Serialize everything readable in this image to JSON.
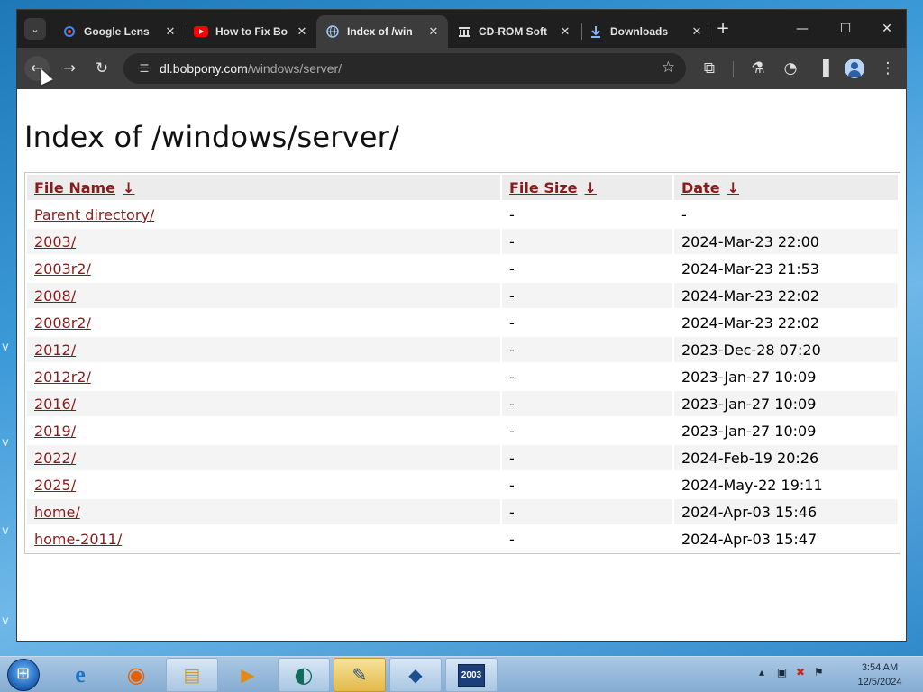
{
  "browser": {
    "tabs": [
      {
        "title": "Google Lens",
        "icon": "google-lens-icon",
        "active": false
      },
      {
        "title": "How to Fix Bo",
        "icon": "youtube-icon",
        "active": false
      },
      {
        "title": "Index of /win",
        "icon": "globe-icon",
        "active": true
      },
      {
        "title": "CD-ROM Soft",
        "icon": "archive-icon",
        "active": false
      },
      {
        "title": "Downloads",
        "icon": "download-icon",
        "active": false
      }
    ],
    "tab_close_glyph": "✕",
    "new_tab_glyph": "+",
    "url_host": "dl.bobpony.com",
    "url_path": "/windows/server/"
  },
  "page": {
    "title": "Index of /windows/server/",
    "headers": {
      "name": "File Name",
      "size": "File Size",
      "date": "Date",
      "sort_arrow": "↓"
    },
    "rows": [
      {
        "name": "Parent directory/",
        "size": "-",
        "date": "-"
      },
      {
        "name": "2003/",
        "size": "-",
        "date": "2024-Mar-23 22:00"
      },
      {
        "name": "2003r2/",
        "size": "-",
        "date": "2024-Mar-23 21:53"
      },
      {
        "name": "2008/",
        "size": "-",
        "date": "2024-Mar-23 22:02"
      },
      {
        "name": "2008r2/",
        "size": "-",
        "date": "2024-Mar-23 22:02"
      },
      {
        "name": "2012/",
        "size": "-",
        "date": "2023-Dec-28 07:20"
      },
      {
        "name": "2012r2/",
        "size": "-",
        "date": "2023-Jan-27 10:09"
      },
      {
        "name": "2016/",
        "size": "-",
        "date": "2023-Jan-27 10:09"
      },
      {
        "name": "2019/",
        "size": "-",
        "date": "2023-Jan-27 10:09"
      },
      {
        "name": "2022/",
        "size": "-",
        "date": "2024-Feb-19 20:26"
      },
      {
        "name": "2025/",
        "size": "-",
        "date": "2024-May-22 19:11"
      },
      {
        "name": "home/",
        "size": "-",
        "date": "2024-Apr-03 15:46"
      },
      {
        "name": "home-2011/",
        "size": "-",
        "date": "2024-Apr-03 15:47"
      }
    ]
  },
  "taskbar": {
    "apps": [
      {
        "name": "internet-explorer-icon",
        "glyph": "e"
      },
      {
        "name": "firefox-icon",
        "glyph": "◉"
      },
      {
        "name": "file-explorer-icon",
        "glyph": "▤"
      },
      {
        "name": "media-player-icon",
        "glyph": "▶"
      },
      {
        "name": "browser-icon",
        "glyph": "◐"
      },
      {
        "name": "installer-icon",
        "glyph": "✎"
      },
      {
        "name": "virtualbox-icon",
        "glyph": "◆"
      },
      {
        "name": "windows-server-2003-icon",
        "glyph": "2003"
      }
    ],
    "time": "3:54 AM",
    "date": "12/5/2024"
  },
  "colors": {
    "link": "#8b1a1a",
    "chrome_dark": "#1f1f1f",
    "toolbar": "#3c3c3c",
    "taskbar": "#a9c8e4"
  }
}
